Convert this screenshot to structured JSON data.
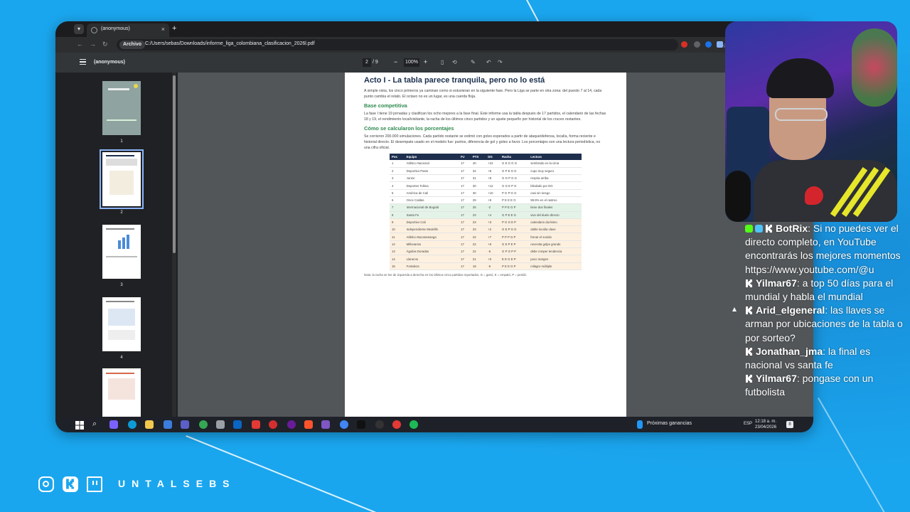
{
  "browser": {
    "tab_title": "(anonymous)",
    "tab_close": "×",
    "new_tab": "+",
    "address_chip": "Archivo",
    "url": "C:/Users/sebas/Downloads/informe_liga_colombiana_clasificacion_2026l.pdf"
  },
  "pdf_toolbar": {
    "title": "(anonymous)",
    "page_current": "2",
    "page_total": "/ 9",
    "zoom": "100%"
  },
  "thumbnails": [
    {
      "num": "1"
    },
    {
      "num": "2"
    },
    {
      "num": "3"
    },
    {
      "num": "4"
    }
  ],
  "document": {
    "heading": "Acto I - La tabla parece tranquila, pero no lo está",
    "intro": "A simple vista, los cinco primeros ya caminan como si estuvieran en la siguiente fase. Pero la Liga se parte en otra zona: del puesto 7 al 14, cada punto cambia el relato. El octavo no es un lugar, es una cuerda floja.",
    "section1_title": "Base competitiva",
    "section1_text": "La fase I tiene 19 jornadas y clasifican los ocho mejores a la fase final. Este informe usa la tabla después de 17 partidos, el calendario de las fechas 18 y 19, el rendimiento local/visitante, la racha de los últimos cinco partidos y un ajuste pequeño por historial de los cruces restantes.",
    "section2_title": "Cómo se calcularon los porcentajes",
    "section2_text": "Se corrieron 200.000 simulaciones. Cada partido restante se estimó con goles esperados a partir de ataque/defensa, localía, forma reciente e historial directo. El desempate usado en el modelo fue: puntos, diferencia de gol y goles a favor. Los porcentajes son una lectura periodística, no una cifra oficial.",
    "table_headers": [
      "Pos",
      "Equipo",
      "PJ",
      "PTS",
      "DG",
      "Racha",
      "Lectura"
    ],
    "table_rows": [
      [
        "1",
        "Atlético Nacional",
        "17",
        "40",
        "+22",
        "G E G G G",
        "sembrado en la cima"
      ],
      [
        "2",
        "Deportivo Pasto",
        "17",
        "34",
        "+8",
        "G P E G G",
        "cupo muy seguro"
      ],
      [
        "3",
        "Junior",
        "17",
        "31",
        "+8",
        "G G P G G",
        "respira arriba"
      ],
      [
        "4",
        "Deportes Tolima",
        "17",
        "30",
        "+12",
        "G G E P G",
        "blindado por DG"
      ],
      [
        "5",
        "América de Cali",
        "17",
        "30",
        "+10",
        "P G P G G",
        "casi sin riesgo"
      ],
      [
        "6",
        "Once Caldas",
        "17",
        "29",
        "+8",
        "P E E E G",
        "99.9% en el rastreo"
      ],
      [
        "7",
        "Internacional de Bogotá",
        "17",
        "25",
        "-2",
        "P P E G P",
        "tiene dos finales"
      ],
      [
        "8",
        "Santa Fe",
        "17",
        "23",
        "+4",
        "G P E E G",
        "vive del duelo directo"
      ],
      [
        "9",
        "Deportivo Cali",
        "17",
        "23",
        "+3",
        "P G G E P",
        "calendario durísimo"
      ],
      [
        "10",
        "Independiente Medellín",
        "17",
        "23",
        "+2",
        "G E P G G",
        "doble localía clave"
      ],
      [
        "11",
        "Atlético Bucaramanga",
        "17",
        "22",
        "+7",
        "P P P G P",
        "frenar el sonido"
      ],
      [
        "12",
        "Millonarios",
        "17",
        "22",
        "+6",
        "G E P E P",
        "necesita golpe grande"
      ],
      [
        "13",
        "Águilas Doradas",
        "17",
        "22",
        "-6",
        "G P G P P",
        "debe romper tendencia"
      ],
      [
        "14",
        "Llaneros",
        "17",
        "21",
        "+0",
        "E E G E P",
        "poco margen"
      ],
      [
        "15",
        "Fortaleza",
        "17",
        "19",
        "-5",
        "P E E G P",
        "milagro múltiple"
      ]
    ],
    "note": "Nota: la racha se lee de izquierda a derecha en los últimos cinco partidos reportados. G = ganó, E = empató, P = perdió."
  },
  "taskbar": {
    "weather_label": "Próximas ganancias",
    "language": "ESP",
    "time": "12:18 a. m.",
    "date": "23/04/2026",
    "notifications": "8"
  },
  "chat": {
    "messages": [
      {
        "user": "BotRix",
        "text": ": Si no puedes ver el directo completo, en YouTube encontrarás los mejores momentos https://www.youtube.com/@u"
      },
      {
        "user": "Yilmar67",
        "text": ": a top 50 días para el mundial y habla el mundial"
      },
      {
        "user": "Arid_elgeneral",
        "text": ": las llaves se arman por ubicaciones de la tabla o por sorteo?"
      },
      {
        "user": "Jonathan_jma",
        "text": ": la final es nacional vs santa fe"
      },
      {
        "user": "Yilmar67",
        "text": ": pongase con un futbolista"
      }
    ]
  },
  "footer": {
    "brand": "UNTALSEBS"
  },
  "colors": {
    "background": "#1aa6ee",
    "table_header": "#1e2f4e",
    "section_title": "#2f8a4f",
    "zone_green": "#e4f3e7",
    "zone_orange": "#fdf0df",
    "kick": "#53fc18"
  }
}
